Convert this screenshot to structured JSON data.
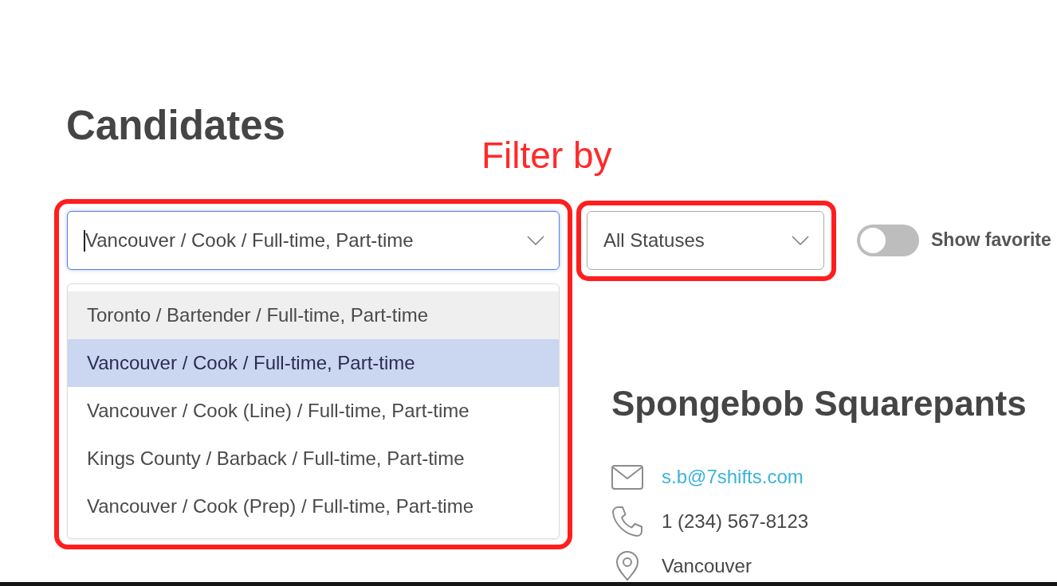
{
  "page": {
    "title": "Candidates"
  },
  "annotations": [
    {
      "kind": "label",
      "text": "Filter by"
    }
  ],
  "filters": {
    "location_select": {
      "value": "Vancouver / Cook / Full-time, Part-time",
      "focused": true,
      "highlighted": true,
      "expanded": true,
      "options": [
        {
          "label": "Toronto / Bartender / Full-time, Part-time",
          "selected": false,
          "hovered": true
        },
        {
          "label": "Vancouver / Cook / Full-time, Part-time",
          "selected": true,
          "hovered": false
        },
        {
          "label": "Vancouver / Cook (Line) / Full-time, Part-time",
          "selected": false,
          "hovered": false
        },
        {
          "label": "Kings County / Barback / Full-time, Part-time",
          "selected": false,
          "hovered": false
        },
        {
          "label": "Vancouver / Cook (Prep) / Full-time, Part-time",
          "selected": false,
          "hovered": false
        }
      ]
    },
    "status_select": {
      "value": "All Statuses",
      "focused": false,
      "highlighted": true
    },
    "favorites_toggle": {
      "label": "Show favorite",
      "on": false
    }
  },
  "candidate": {
    "name": "Spongebob Squarepants",
    "contacts": [
      {
        "kind": "email",
        "text": "s.b@7shifts.com"
      },
      {
        "kind": "phone",
        "text": "1 (234) 567-8123"
      },
      {
        "kind": "location",
        "text": "Vancouver"
      }
    ]
  }
}
